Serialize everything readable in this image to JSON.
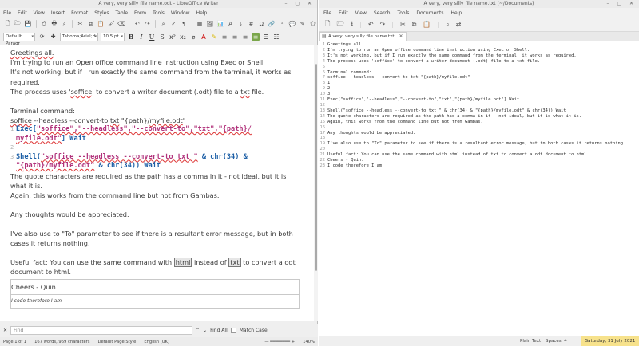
{
  "writer": {
    "title": "A very, very silly file name.odt - LibreOffice Writer",
    "menu": [
      "File",
      "Edit",
      "View",
      "Insert",
      "Format",
      "Styles",
      "Table",
      "Form",
      "Tools",
      "Window",
      "Help"
    ],
    "paragraph_style": "Default Paragr",
    "font_name": "Tahoma;Arial;H",
    "font_size": "10.5 pt",
    "doc": {
      "p1": "Greetings all.",
      "p2": "I'm trying to run an Open office command line instruction using Exec or Shell.",
      "p3": "It's not working, but if I run exactly the same command from the terminal, it works as required.",
      "p4a": "The process uses '",
      "p4b": "soffice",
      "p4c": "' to convert a writer document (.odt) file to a ",
      "p4d": "txt",
      "p4e": " file.",
      "p5": "Terminal command:",
      "p6a": "soffice",
      "p6b": " --headless --convert-to ",
      "p6c": "txt",
      "p6d": " \"{path}/",
      "p6e": "myfile.odt",
      "p6f": "\"",
      "code1_num": "1",
      "code1a": "Exec[",
      "code1b": "\"soffice\",\"--headless\",\"--convert-to\",\"txt\",\"{path}/",
      "code1c": "myfile.odt\"",
      "code1d": "] Wait",
      "code2_num": "2",
      "code3_num": "3",
      "code3a": "Shell(",
      "code3b": "\"soffice --headless --convert-to txt \"",
      "code3c": " & chr(34) &",
      "code3d": "\"{path}/myfile.odt\"",
      "code3e": " & chr(34)) Wait",
      "p7": "The quote characters are required as the path has a comma in it - not ideal, but it is what it is.",
      "p8": "Again, this works from the command line but not from Gambas.",
      "p9": "Any thoughts would be appreciated.",
      "p10": "I've also use to \"To\" parameter to see if there is a resultant error message, but in both cases it returns nothing.",
      "p11a": "Useful fact: You can use the same command with ",
      "p11b": "html",
      "p11c": " instead of ",
      "p11d": "txt",
      "p11e": " to convert a odt document to html.",
      "sig1": "Cheers - Quin.",
      "sig2": "I code therefore I am"
    },
    "find": {
      "placeholder": "Find",
      "find_all": "Find All",
      "match_case": "Match Case"
    },
    "status": {
      "page": "Page 1 of 1",
      "words": "167 words, 969 characters",
      "page_style": "Default Page Style",
      "language": "English (UK)",
      "zoom": "140%"
    }
  },
  "gedit": {
    "title": "A very, very silly file name.txt (~/Documents)",
    "menu": [
      "File",
      "Edit",
      "View",
      "Search",
      "Tools",
      "Documents",
      "Help"
    ],
    "tab": "A very, very silly file name.txt",
    "lines": [
      {
        "n": "1",
        "t": "Greetings all."
      },
      {
        "n": "2",
        "t": "I'm trying to run an Open office command line instruction using Exec or Shell."
      },
      {
        "n": "3",
        "t": "It's not working, but if I run exactly the same command from the terminal, it works as required."
      },
      {
        "n": "4",
        "t": "The process uses 'soffice' to convert a writer document (.odt) file to a txt file."
      },
      {
        "n": "5",
        "t": ""
      },
      {
        "n": "6",
        "t": "Terminal command:"
      },
      {
        "n": "7",
        "t": "soffice --headless --convert-to txt \"{path}/myfile.odt\""
      },
      {
        "n": "8",
        "t": "1"
      },
      {
        "n": "9",
        "t": "2"
      },
      {
        "n": "10",
        "t": "3"
      },
      {
        "n": "11",
        "t": "Exec[\"soffice\",\"--headless\",\"--convert-to\",\"txt\",\"{path}/myfile.odt\"] Wait"
      },
      {
        "n": "12",
        "t": ""
      },
      {
        "n": "13",
        "t": "Shell(\"soffice --headless --convert-to txt \" & chr(34) & \"{path}/myfile.odt\" & chr(34)) Wait"
      },
      {
        "n": "14",
        "t": "The quote characters are required as the path has a comma in it - not ideal, but it is what it is."
      },
      {
        "n": "15",
        "t": "Again, this works from the command line but not from Gambas."
      },
      {
        "n": "16",
        "t": ""
      },
      {
        "n": "17",
        "t": "Any thoughts would be appreciated."
      },
      {
        "n": "18",
        "t": ""
      },
      {
        "n": "19",
        "t": "I've also use to \"To\" parameter to see if there is a resultant error message, but in both cases it returns nothing."
      },
      {
        "n": "20",
        "t": ""
      },
      {
        "n": "21",
        "t": "Useful fact: You can use the same command with html instead of txt to convert a odt document to html."
      },
      {
        "n": "22",
        "t": "Cheers - Quin."
      },
      {
        "n": "23",
        "t": "I code therefore I am"
      }
    ],
    "status": {
      "language": "Plain Text",
      "spaces": "Spaces: 4",
      "date": "Saturday, 31 July 2021"
    }
  }
}
